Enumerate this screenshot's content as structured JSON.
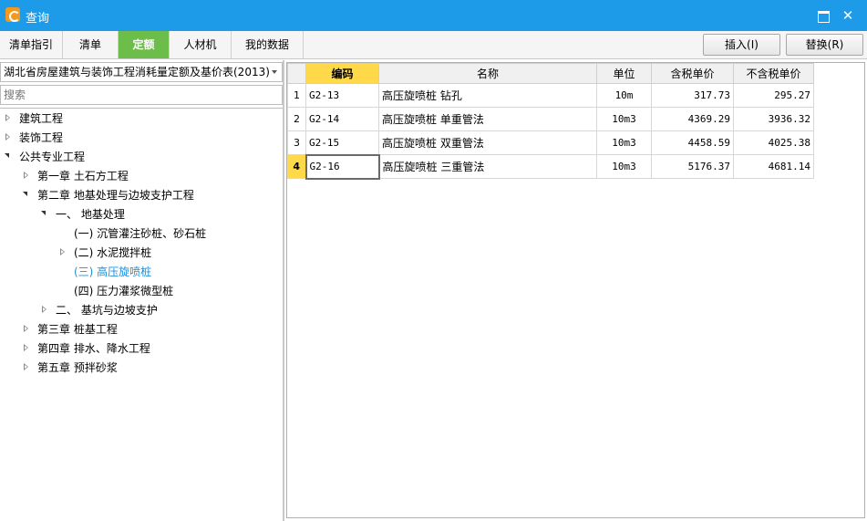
{
  "window": {
    "title": "查询",
    "maximize_icon": "maximize-icon",
    "close_symbol": "✕"
  },
  "tabs": [
    {
      "label": "清单指引",
      "active": false
    },
    {
      "label": "清单",
      "active": false
    },
    {
      "label": "定额",
      "active": true
    },
    {
      "label": "人材机",
      "active": false
    },
    {
      "label": "我的数据",
      "active": false
    }
  ],
  "actions": {
    "insert_label": "插入(I)",
    "replace_label": "替换(R)"
  },
  "library": {
    "selected": "湖北省房屋建筑与装饰工程消耗量定额及基价表(2013)"
  },
  "search": {
    "placeholder": "搜索"
  },
  "tree": [
    {
      "label": "建筑工程",
      "expander": "closed",
      "selected": false
    },
    {
      "label": "装饰工程",
      "expander": "closed",
      "selected": false
    },
    {
      "label": "公共专业工程",
      "expander": "open",
      "selected": false
    },
    {
      "label": "第一章 土石方工程",
      "expander": "closed",
      "selected": false
    },
    {
      "label": "第二章 地基处理与边坡支护工程",
      "expander": "open",
      "selected": false
    },
    {
      "label": "一、 地基处理",
      "expander": "open",
      "selected": false
    },
    {
      "label": "(一) 沉管灌注砂桩、砂石桩",
      "expander": "none",
      "selected": false
    },
    {
      "label": "(二) 水泥搅拌桩",
      "expander": "closed",
      "selected": false
    },
    {
      "label": "(三) 高压旋喷桩",
      "expander": "none",
      "selected": true
    },
    {
      "label": "(四) 压力灌浆微型桩",
      "expander": "none",
      "selected": false
    },
    {
      "label": "二、 基坑与边坡支护",
      "expander": "closed",
      "selected": false
    },
    {
      "label": "第三章 桩基工程",
      "expander": "closed",
      "selected": false
    },
    {
      "label": "第四章 排水、降水工程",
      "expander": "closed",
      "selected": false
    },
    {
      "label": "第五章 预拌砂浆",
      "expander": "closed",
      "selected": false
    }
  ],
  "grid": {
    "columns": [
      "",
      "编码",
      "名称",
      "单位",
      "含税单价",
      "不含税单价"
    ],
    "rows": [
      {
        "no": "1",
        "code": "G2-13",
        "name": "高压旋喷桩 钻孔",
        "unit": "10m",
        "price_tax": "317.73",
        "price_notax": "295.27",
        "current": false
      },
      {
        "no": "2",
        "code": "G2-14",
        "name": "高压旋喷桩 单重管法",
        "unit": "10m3",
        "price_tax": "4369.29",
        "price_notax": "3936.32",
        "current": false
      },
      {
        "no": "3",
        "code": "G2-15",
        "name": "高压旋喷桩 双重管法",
        "unit": "10m3",
        "price_tax": "4458.59",
        "price_notax": "4025.38",
        "current": false
      },
      {
        "no": "4",
        "code": "G2-16",
        "name": "高压旋喷桩 三重管法",
        "unit": "10m3",
        "price_tax": "5176.37",
        "price_notax": "4681.14",
        "current": true
      }
    ]
  },
  "colors": {
    "titlebar": "#1e9be8",
    "active_tab": "#6dbd4a",
    "header_highlight": "#ffd94a",
    "selected_tree_text": "#1e8fd8"
  }
}
